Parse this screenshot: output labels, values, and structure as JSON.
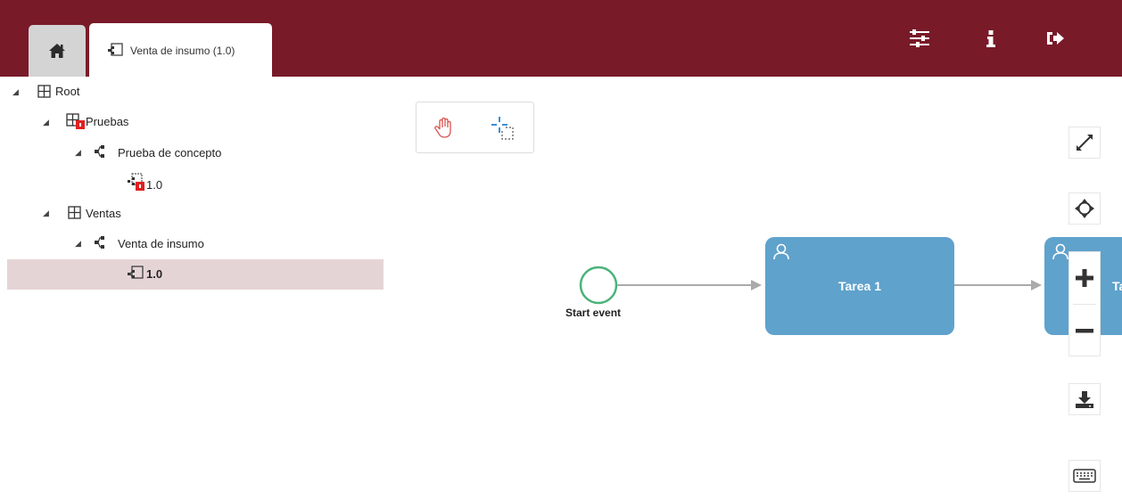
{
  "header": {
    "bg_color": "#791a29",
    "home_icon": "home-icon",
    "active_tab_icon": "process-version-icon",
    "active_tab_label": "Venta de insumo (1.0)",
    "right_icons": [
      "sliders-icon",
      "info-icon",
      "logout-icon"
    ]
  },
  "tree": {
    "nodes": [
      {
        "label": "Root",
        "icon": "grid-icon",
        "level": 0
      },
      {
        "label": "Pruebas",
        "icon": "grid-locked-icon",
        "level": 1
      },
      {
        "label": "Prueba de concepto",
        "icon": "process-icon",
        "level": 2
      },
      {
        "label": "1.0",
        "icon": "version-locked-icon",
        "level": 3
      },
      {
        "label": "Ventas",
        "icon": "grid-icon",
        "level": 1
      },
      {
        "label": "Venta de insumo",
        "icon": "process-icon",
        "level": 2
      },
      {
        "label": "1.0",
        "icon": "version-icon",
        "level": 3,
        "selected": true
      }
    ],
    "selected_color": "#e5d4d6"
  },
  "palette": {
    "tools": [
      "hand-tool-icon",
      "lasso-tool-icon"
    ]
  },
  "diagram": {
    "start_event_label": "Start event",
    "task_color": "#5fa2cc",
    "tasks": [
      {
        "label": "Tarea 1"
      },
      {
        "label": "Ta"
      }
    ]
  },
  "controls": {
    "items": [
      "fit-viewport-icon",
      "center-icon",
      "zoom-in-icon",
      "zoom-out-icon",
      "download-icon",
      "keyboard-icon"
    ]
  }
}
